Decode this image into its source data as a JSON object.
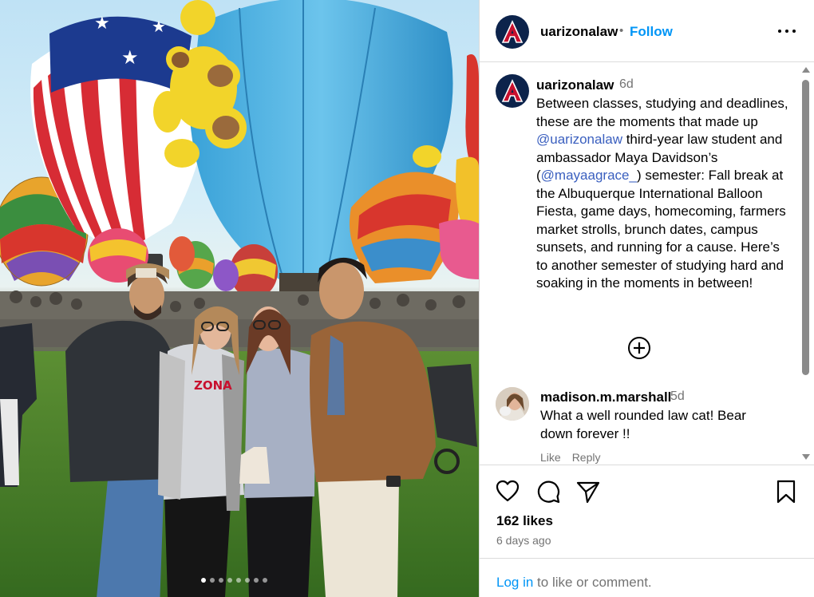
{
  "post": {
    "username": "uarizonalaw",
    "follow_label": "Follow",
    "separator": "•",
    "logo_letter": "A",
    "brand_color": "#0c234b",
    "accent_color": "#c8102e",
    "caption": {
      "time": "6d",
      "part1": "Between classes, studying and deadlines, these are the moments that made up ",
      "mention1": "@uarizonalaw",
      "part2": " third-year law student and ambassador Maya Davidson’s (",
      "mention2": "@mayaagrace_",
      "part3": ") semester: Fall break at the Albuquerque International Balloon Fiesta, game days, homecoming, farmers market strolls, brunch dates, campus sunsets, and running for a cause. Here’s to another semester of studying hard and soaking in the moments in between!"
    },
    "comment": {
      "username": "madison.m.marshall",
      "time": "5d",
      "text": "What a well rounded law cat! Bear down forever !!",
      "like_label": "Like",
      "reply_label": "Reply"
    },
    "likes": "162 likes",
    "posted_ago": "6 days ago",
    "login": {
      "link": "Log in",
      "rest": " to like or comment."
    },
    "carousel": {
      "count": 8,
      "active_index": 0
    }
  },
  "photo": {
    "shirt_text": "ZONA"
  },
  "icons": {
    "more": "more-options-icon",
    "add_comments": "plus-circle-icon",
    "like": "heart-icon",
    "comment": "comment-bubble-icon",
    "share": "paper-plane-icon",
    "save": "bookmark-icon"
  }
}
